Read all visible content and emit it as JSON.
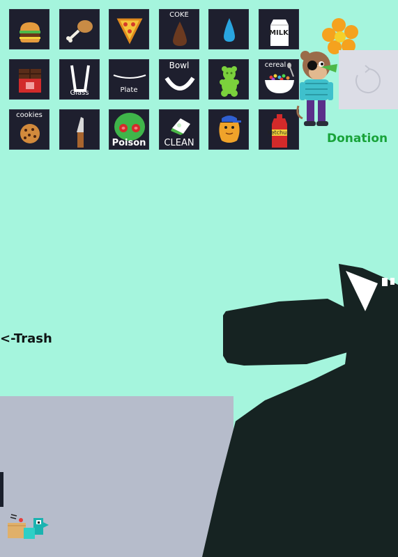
{
  "items": [
    {
      "name": "burger",
      "caption": ""
    },
    {
      "name": "chicken-leg",
      "caption": ""
    },
    {
      "name": "pizza",
      "caption": ""
    },
    {
      "name": "coke",
      "caption": "COKE"
    },
    {
      "name": "water",
      "caption": ""
    },
    {
      "name": "milk",
      "caption": "MILK"
    },
    {
      "name": "chocolate",
      "caption": ""
    },
    {
      "name": "glass",
      "caption": "Glass"
    },
    {
      "name": "plate",
      "caption": "Plate"
    },
    {
      "name": "bowl",
      "caption": "Bowl"
    },
    {
      "name": "gummy-bear",
      "caption": ""
    },
    {
      "name": "cereal",
      "caption": "cereal"
    },
    {
      "name": "cookies",
      "caption": "cookies"
    },
    {
      "name": "knife",
      "caption": ""
    },
    {
      "name": "poison",
      "caption": "Poison"
    },
    {
      "name": "clean",
      "caption": "CLEAN"
    },
    {
      "name": "nugget",
      "caption": ""
    },
    {
      "name": "ketchup",
      "caption": "Ketchup"
    }
  ],
  "donation": {
    "label": "Donation"
  },
  "trash": {
    "label": "<-Trash"
  },
  "colors": {
    "background": "#a5f5dd",
    "tile": "#1e1f2e",
    "trash_zone": "#b6bccb",
    "donation": "#19a33a",
    "creature": "#162322"
  }
}
